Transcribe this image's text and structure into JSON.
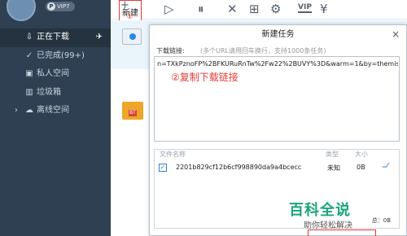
{
  "sidebar": {
    "vip_badge": "VIP7",
    "items": [
      {
        "label": "正在下载",
        "icon": "download-arrow-icon",
        "active": true
      },
      {
        "label": "已完成(99+)",
        "icon": "check-circle-icon",
        "active": false
      },
      {
        "label": "私人空间",
        "icon": "private-space-icon",
        "active": false
      },
      {
        "label": "垃圾箱",
        "icon": "trash-icon",
        "active": false
      },
      {
        "label": "离线空间",
        "icon": "cloud-icon",
        "active": false,
        "expandable": true
      }
    ]
  },
  "toolbar": {
    "new_label": "新建",
    "new_annotation": "①",
    "vip_label": "VIP"
  },
  "dialog": {
    "title": "新建任务",
    "close": "×",
    "download_link_label": "下载链接:",
    "hint": "(多个URL请用回车换行，支持1000条任务)",
    "url_value": "n=TXkPznoFP%2BFKURuRnTw%2Fw22%2BUVY%3D&warm=1&by=themis",
    "annotation": "②复制下载链接",
    "files_header": {
      "name": "文件名称",
      "type": "类型",
      "size": "大小"
    },
    "files": [
      {
        "name": "2201b829cf12b6cf998890da9a4bcecc",
        "type": "未知",
        "size": "0B",
        "checked": true
      }
    ],
    "total": "总：0B"
  },
  "list": {
    "bt_tag": "BT"
  },
  "watermark": {
    "main": "百科全说",
    "sub": "助你轻松解决"
  },
  "colors": {
    "sidebar_bg": "#2f4052",
    "annotation_red": "#e53935",
    "watermark_green": "#1aa57c"
  }
}
